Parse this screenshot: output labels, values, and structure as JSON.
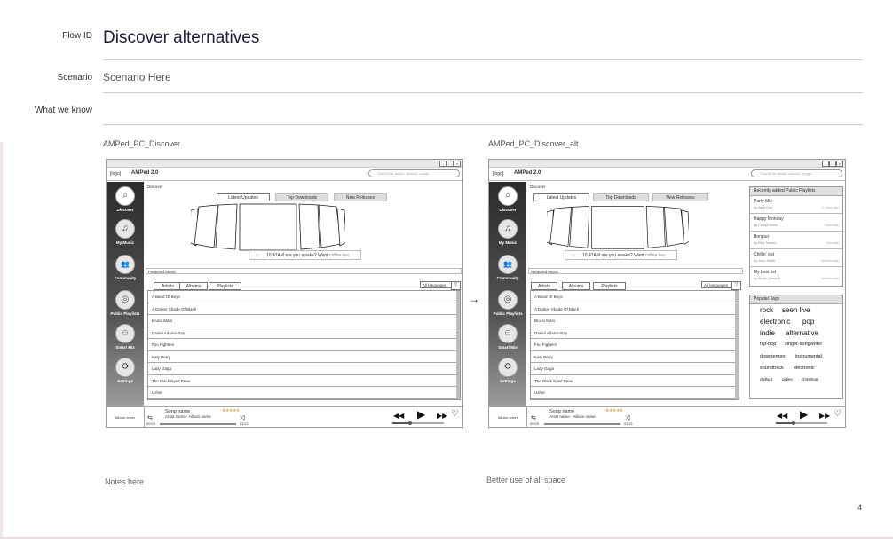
{
  "doc": {
    "flow_label": "Flow ID",
    "flow_title": "Discover alternatives",
    "scenario_label": "Scenario",
    "scenario_value": "Scenario Here",
    "know_label": "What we know",
    "page_number": "4"
  },
  "captions": {
    "left": "AMPed_PC_Discover",
    "right": "AMPed_PC_Discover_alt"
  },
  "notes": {
    "left": "Notes here",
    "right": "Better use of all space"
  },
  "app": {
    "logo": "[logo]",
    "name": "AMPed 2.0",
    "search_placeholder": "Search for artists, albums, songs",
    "window_min": "–",
    "window_max": "□",
    "window_close": "x",
    "nav": [
      {
        "label": "Discover",
        "icon": "⌕"
      },
      {
        "label": "My Music",
        "icon": "♫"
      },
      {
        "label": "Community",
        "icon": "👥"
      },
      {
        "label": "Public Playlists",
        "icon": "◎"
      },
      {
        "label": "Smart Mix",
        "icon": "☺"
      },
      {
        "label": "Settings",
        "icon": "⚙"
      }
    ],
    "discover_label": "Discover",
    "tabs": [
      "Latest Updates",
      "Top Downloads",
      "New Releases"
    ],
    "notification": {
      "sun": "☼",
      "text": "10:47AM are you awake? Want ",
      "link": "coffee tea"
    },
    "featured_label": "Featured Music",
    "subtabs": [
      "Artists",
      "Albums",
      "Playlists"
    ],
    "language": "All languages",
    "language_dd": "▽",
    "artists": [
      "A Band Of Boys",
      "A Darker Shade Of Black",
      "Bruno Mars",
      "Daniel Adams-Ray",
      "Foo Fighters",
      "Katy Perry",
      "Lady Gaga",
      "The Black Eyed Peas",
      "Usher"
    ],
    "player": {
      "album_cover": "Album cover",
      "song": "Song name",
      "artist_album": "Artist name - Album name",
      "stars": "★★★★★",
      "time_start": "00:00",
      "time_end": "03:21",
      "repeat": "⇆",
      "shuffle": "⤨",
      "prev": "◀◀",
      "play": "▶",
      "next": "▶▶",
      "heart": "♡",
      "volume": 0.35
    }
  },
  "alt": {
    "recent_title": "Recently added Public Playlists",
    "playlists": [
      {
        "name": "Party Mix",
        "by": "by Jane Doe",
        "when": "6 mins ago"
      },
      {
        "name": "Happy Monday",
        "by": "by CrazyDancer",
        "when": "Yesterday"
      },
      {
        "name": "Bonjour",
        "by": "by Eliot Tanner",
        "when": "Monday"
      },
      {
        "name": "Chillin' out",
        "by": "by John Smith",
        "when": "Wednesday"
      },
      {
        "name": "My best list",
        "by": "by Annie Johnson",
        "when": "Wednesday"
      }
    ],
    "tags_title": "Popular Tags",
    "tags": [
      "rock",
      "seen live",
      "electronic",
      "pop",
      "indie",
      "alternative",
      "hip-hop",
      "singer-songwriter",
      "downtempo",
      "instrumental",
      "soundtrack",
      "electronic",
      "chillout",
      "oldies",
      "christmas"
    ]
  },
  "arrow": "→"
}
